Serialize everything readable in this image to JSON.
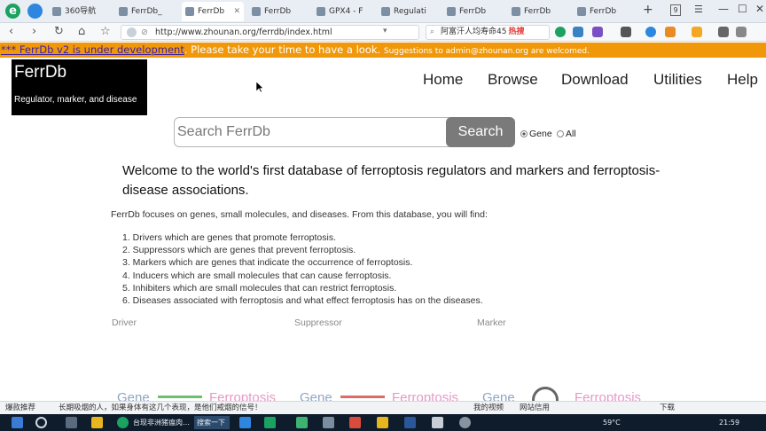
{
  "browser": {
    "tabs": [
      {
        "label": "360导航"
      },
      {
        "label": "FerrDb_"
      },
      {
        "label": "FerrDb",
        "active": true
      },
      {
        "label": "FerrDb"
      },
      {
        "label": "GPX4 - F"
      },
      {
        "label": "Regulati"
      },
      {
        "label": "FerrDb"
      },
      {
        "label": "FerrDb"
      },
      {
        "label": "FerrDb"
      }
    ],
    "tab_counter": "9",
    "url": "http://www.zhounan.org/ferrdb/index.html",
    "search_text": "阿富汗人均寿命45",
    "search_hot": "热搜"
  },
  "banner": {
    "link": "*** FerrDb v2 is under development",
    "text": ". Please take your time to have a look.",
    "suggest": "Suggestions to admin@zhounan.org are welcomed."
  },
  "site": {
    "name": "FerrDb",
    "tagline": "Regulator, marker, and disease",
    "nav": [
      "Home",
      "Browse",
      "Download",
      "Utilities",
      "Help"
    ]
  },
  "search": {
    "placeholder": "Search FerrDb",
    "button": "Search",
    "options": [
      "Gene",
      "All"
    ],
    "selected": "Gene"
  },
  "content": {
    "welcome": "Welcome to the world's first database of ferroptosis regulators and markers and ferroptosis-disease associations.",
    "intro": "FerrDb focuses on genes, small molecules, and diseases. From this database, you will find:",
    "items": [
      "1. Drivers which are genes that promote ferroptosis.",
      "2. Suppressors which are genes that prevent ferroptosis.",
      "3. Markers which are genes that indicate the occurrence of ferroptosis.",
      "4. Inducers which are small molecules that can cause ferroptosis.",
      "5. Inhibiters which are small molecules that can restrict ferroptosis.",
      "6. Diseases associated with ferroptosis and what effect ferroptosis has on the diseases."
    ],
    "categories": [
      "Driver",
      "Suppressor",
      "Marker"
    ],
    "diagram": [
      "Gene",
      "Ferroptosis",
      "Gene",
      "Ferroptosis",
      "Gene",
      "Ferroptosis"
    ]
  },
  "statusbar": {
    "left": "爆款推荐",
    "news": "长期吸烟的人，如果身体有这几个表现，是他们戒烟的信号！",
    "right1": "我的视频",
    "right2": "网站信用",
    "right3": "下载"
  },
  "taskbar": {
    "app_title": "台现非洲猪瘟肉…",
    "search_label": "搜索一下",
    "temp": "59°C",
    "time": "21:59"
  },
  "colors": {
    "banner": "#f0980a",
    "logo_bg": "#000000",
    "search_button": "#7a7a7a"
  }
}
